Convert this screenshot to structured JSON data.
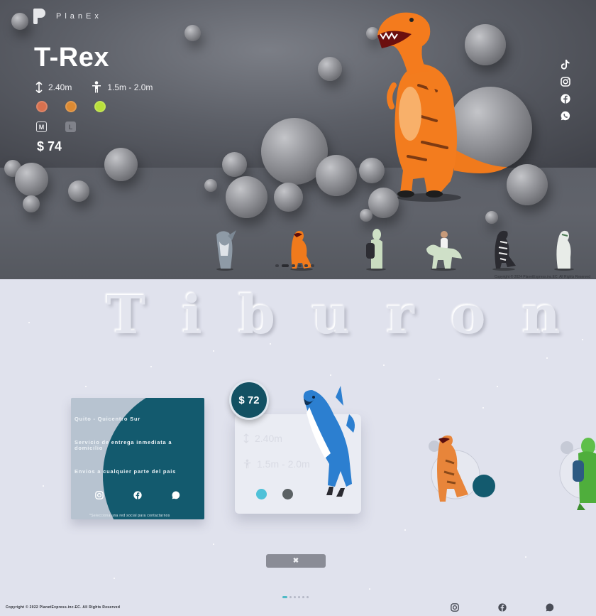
{
  "brand": {
    "name": "PlanEx"
  },
  "hero": {
    "title": "T-Rex",
    "height": "2.40m",
    "person_range": "1.5m  -  2.0m",
    "colors": [
      "#d8714f",
      "#dc8a32",
      "#b9e03a"
    ],
    "sizes": [
      "M",
      "L"
    ],
    "price": "$ 74",
    "social_icons": [
      "tiktok-icon",
      "instagram-icon",
      "facebook-icon",
      "whatsapp-icon"
    ],
    "thumbnails": [
      "shark-costume",
      "trex-costume",
      "alien-costume",
      "dino-rider-costume",
      "skeleton-dino-costume",
      "white-dino-costume"
    ],
    "copyright": "Copyright © 2024 PlanetExpress.inc.EC. All Rights Reserved"
  },
  "lower": {
    "big_title": [
      "T",
      "i",
      "b",
      "u",
      "r",
      "o",
      "n"
    ],
    "info_card": {
      "location": "Quito - Quicentro Sur",
      "delivery": "Servicio de entrega inmediata a domicilio",
      "shipping": "Envios a cualquier parte del pais",
      "note": "*Selecciona una red social para contactarnos"
    },
    "product": {
      "price": "$ 72",
      "height": "2.40m",
      "person_range": "1.5m - 2.0m",
      "colors": [
        "#4fc1d8",
        "#5b6164"
      ]
    },
    "close_label": "✖",
    "copyright": "Copyright © 2022 PlanetExpress.inc.EC. All Rights Reserved"
  }
}
